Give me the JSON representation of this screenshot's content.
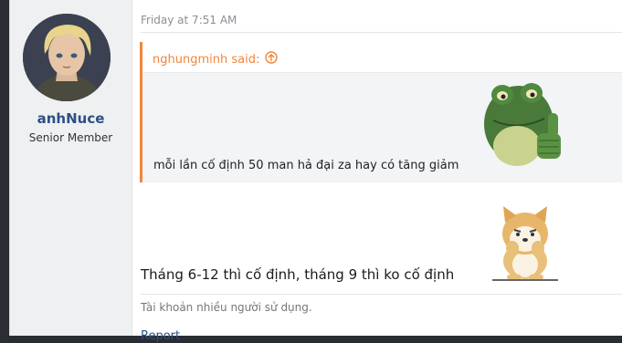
{
  "post": {
    "author": {
      "name": "anhNuce",
      "title": "Senior Member"
    },
    "timestamp": "Friday at 7:51 AM",
    "quote": {
      "author_label": "nghungminh said:",
      "text": "mỗi lần cố định 50 man hả đại za hay có tăng giảm"
    },
    "message": "Tháng 6-12 thì cố định, tháng 9 thì ko cố định",
    "signature": "Tài khoản nhiều người sử dụng.",
    "actions": {
      "report_label": "Report"
    }
  },
  "colors": {
    "accent_orange": "#f0873b",
    "link_blue": "#2d4f84"
  },
  "icons": [
    "up-arrow-circle-icon",
    "avatar",
    "frog-thumbs-up-sticker",
    "shiba-dog-sticker"
  ]
}
